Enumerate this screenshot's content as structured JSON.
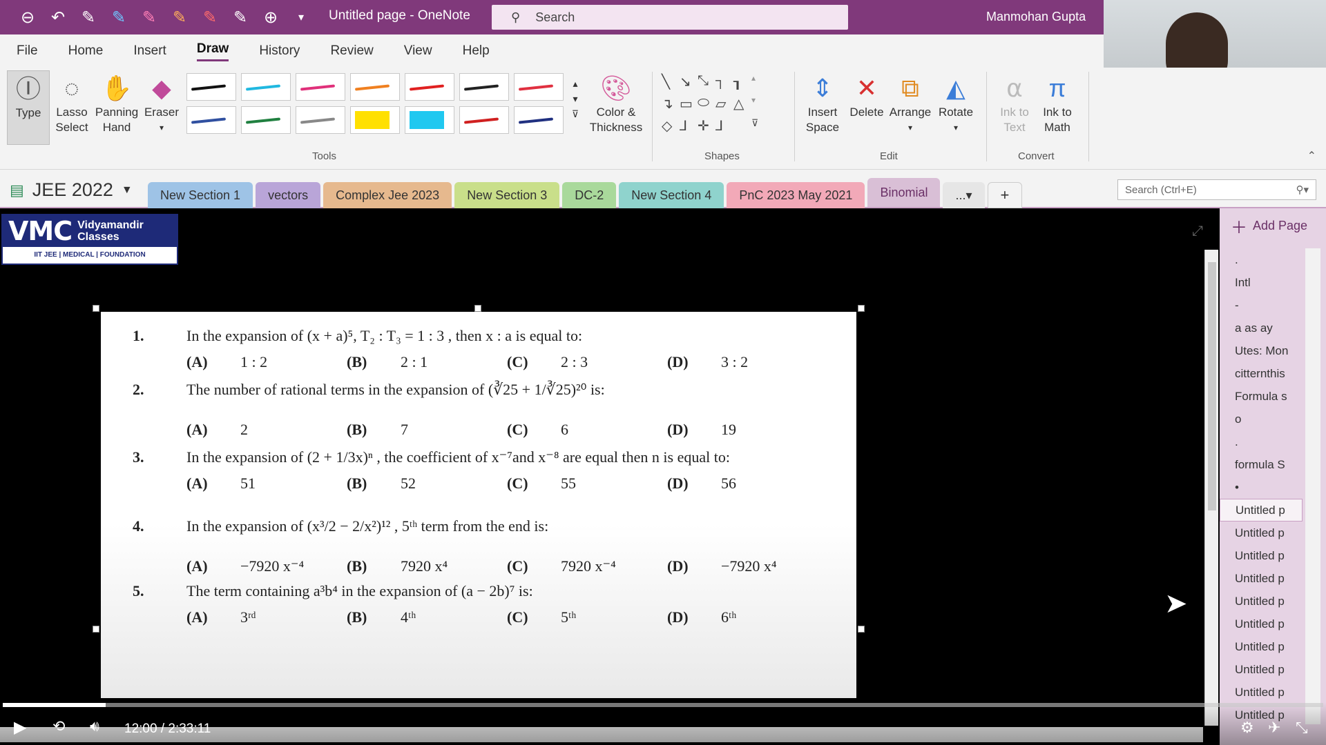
{
  "titlebar": {
    "doc_title": "Untitled page - OneNote",
    "search_placeholder": "Search",
    "user": "Manmohan Gupta"
  },
  "menu": [
    "File",
    "Home",
    "Insert",
    "Draw",
    "History",
    "Review",
    "View",
    "Help"
  ],
  "menu_active": "Draw",
  "ribbon": {
    "type": "Type",
    "lasso": "Lasso Select",
    "panning": "Panning Hand",
    "eraser": "Eraser",
    "color_thickness": "Color & Thickness",
    "insert_space": "Insert Space",
    "delete": "Delete",
    "arrange": "Arrange",
    "rotate": "Rotate",
    "ink_to_text": "Ink to Text",
    "ink_to_math": "Ink to Math",
    "group_tools": "Tools",
    "group_shapes": "Shapes",
    "group_edit": "Edit",
    "group_convert": "Convert",
    "pens": [
      {
        "color": "#111111",
        "kind": "pen"
      },
      {
        "color": "#20b8e0",
        "kind": "pen"
      },
      {
        "color": "#e0307a",
        "kind": "pen"
      },
      {
        "color": "#f08020",
        "kind": "pen"
      },
      {
        "color": "#e02020",
        "kind": "pen"
      },
      {
        "color": "#222222",
        "kind": "pen"
      },
      {
        "color": "#e03040",
        "kind": "pen"
      },
      {
        "color": "#3050a0",
        "kind": "pen"
      },
      {
        "color": "#208040",
        "kind": "pen"
      },
      {
        "color": "#888888",
        "kind": "pen"
      },
      {
        "color": "#ffe000",
        "kind": "highlighter"
      },
      {
        "color": "#20c8f0",
        "kind": "highlighter"
      },
      {
        "color": "#d02020",
        "kind": "pen"
      },
      {
        "color": "#203080",
        "kind": "pen"
      }
    ]
  },
  "notebook": {
    "name": "JEE 2022",
    "sections": [
      {
        "label": "New Section 1",
        "color": "#9ec3e6"
      },
      {
        "label": "vectors",
        "color": "#b9a5d8"
      },
      {
        "label": "Complex Jee 2023",
        "color": "#e6b98e"
      },
      {
        "label": "New Section 3",
        "color": "#c9df8a"
      },
      {
        "label": "DC-2",
        "color": "#a9d99b"
      },
      {
        "label": "New Section 4",
        "color": "#8fd3cd"
      },
      {
        "label": "PnC 2023 May 2021",
        "color": "#f2a9b8"
      },
      {
        "label": "Binomial",
        "color": "#d9bfd6"
      }
    ],
    "more": "...",
    "add": "+",
    "search_placeholder": "Search (Ctrl+E)"
  },
  "logo": {
    "big": "VMC",
    "name1": "Vidyamandir",
    "name2": "Classes",
    "tagline": "IIT JEE | MEDICAL | FOUNDATION"
  },
  "questions": [
    {
      "num": "1.",
      "text": "In the expansion of (x + a)⁵, T₂ : T₃ = 1 : 3 , then  x : a  is equal to:",
      "opts": [
        "1 : 2",
        "2 : 1",
        "2 : 3",
        "3 : 2"
      ]
    },
    {
      "num": "2.",
      "text": "The number of rational terms in the expansion of (∛25 + 1/∛25)²⁰  is:",
      "opts": [
        "2",
        "7",
        "6",
        "19"
      ]
    },
    {
      "num": "3.",
      "text": "In the expansion of (2 + 1/3x)ⁿ , the coefficient of x⁻⁷and x⁻⁸  are equal then n is equal to:",
      "opts": [
        "51",
        "52",
        "55",
        "56"
      ]
    },
    {
      "num": "4.",
      "text": "In the expansion of (x³/2 − 2/x²)¹² , 5ᵗʰ term from the end is:",
      "opts": [
        "−7920 x⁻⁴",
        "7920 x⁴",
        "7920 x⁻⁴",
        "−7920 x⁴"
      ]
    },
    {
      "num": "5.",
      "text": "The term containing  a³b⁴  in the expansion of  (a − 2b)⁷  is:",
      "opts": [
        "3ʳᵈ",
        "4ᵗʰ",
        "5ᵗʰ",
        "6ᵗʰ"
      ]
    }
  ],
  "option_letters": [
    "(A)",
    "(B)",
    "(C)",
    "(D)"
  ],
  "pages": {
    "add_page": "Add Page",
    "items": [
      ".",
      "Intl",
      "-",
      "a as ay",
      "Utes: Mon",
      "citternthis",
      "Formula s",
      "o",
      ".",
      "formula S",
      "•",
      "Untitled p",
      "Untitled p",
      "Untitled p",
      "Untitled p",
      "Untitled p",
      "Untitled p",
      "Untitled p",
      "Untitled p",
      "Untitled p",
      "Untitled p"
    ],
    "selected_index": 11
  },
  "player": {
    "current_time": "12:00",
    "separator": "/",
    "duration": "2:33:11",
    "progress": 0.078
  }
}
